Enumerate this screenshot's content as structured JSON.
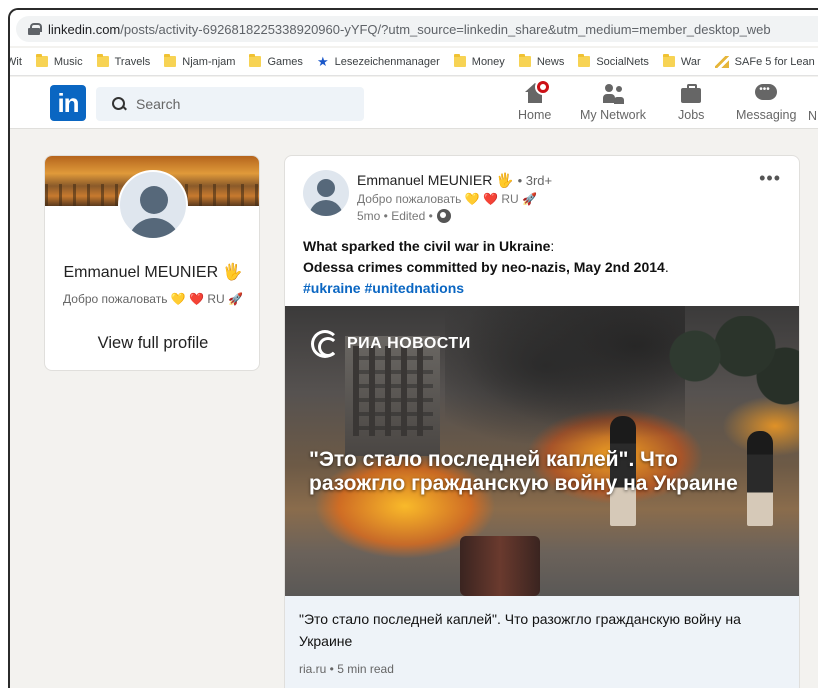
{
  "browser": {
    "url_domain": "linkedin.com",
    "url_rest": "/posts/activity-6926818225338920960-yYFQ/?utm_source=linkedin_share&utm_medium=member_desktop_web",
    "bookmarks": [
      {
        "label": "Wit",
        "icon": "none"
      },
      {
        "label": "Music",
        "icon": "folder-icon"
      },
      {
        "label": "Travels",
        "icon": "folder-icon"
      },
      {
        "label": "Njam-njam",
        "icon": "folder-icon"
      },
      {
        "label": "Games",
        "icon": "folder-icon"
      },
      {
        "label": "Lesezeichenmanager",
        "icon": "star-icon"
      },
      {
        "label": "Money",
        "icon": "folder-icon"
      },
      {
        "label": "News",
        "icon": "folder-icon"
      },
      {
        "label": "SocialNets",
        "icon": "folder-icon"
      },
      {
        "label": "War",
        "icon": "folder-icon"
      },
      {
        "label": "SAFe 5 for Lean",
        "icon": "safe-icon"
      }
    ]
  },
  "header": {
    "logo": "in",
    "search_placeholder": "Search",
    "nav": [
      {
        "label": "Home",
        "icon": "home-icon"
      },
      {
        "label": "My Network",
        "icon": "network-icon"
      },
      {
        "label": "Jobs",
        "icon": "briefcase-icon"
      },
      {
        "label": "Messaging",
        "icon": "messaging-icon"
      },
      {
        "label": "N",
        "icon": "none"
      }
    ],
    "accent": "#0a66c2"
  },
  "profile": {
    "name": "Emmanuel MEUNIER 🖐",
    "headline": "Добро пожаловать 💛 ❤️ RU 🚀",
    "view_label": "View full profile"
  },
  "post": {
    "author": "Emmanuel MEUNIER 🖐",
    "degree": "• 3rd+",
    "headline": "Добро пожаловать 💛 ❤️ RU 🚀",
    "meta": "5mo • Edited •",
    "more": "•••",
    "text_bold_1": "What sparked the civil war in Ukraine",
    "text_colon": ":",
    "text_bold_2": "Odessa crimes committed by neo-nazis, May 2nd 2014",
    "text_period": ".",
    "hashtags": "#ukraine #unitednations",
    "image_logo": "РИА НОВОСТИ",
    "image_overlay": "\"Это стало последней каплей\". Что разожгло гражданскую войну на Украине",
    "link_title": "\"Это стало последней каплей\". Что разожгло гражданскую войну на Украине",
    "link_source": "ria.ru • 5 min read"
  }
}
